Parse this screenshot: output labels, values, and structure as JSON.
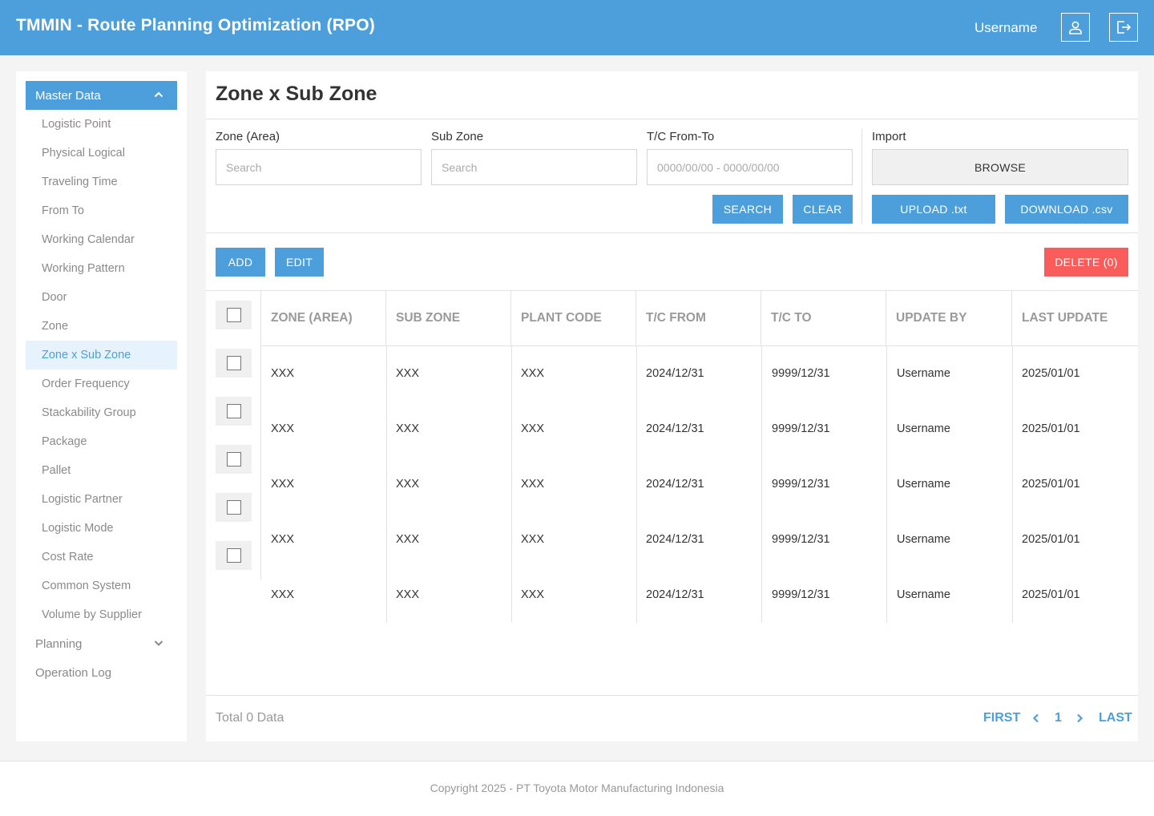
{
  "header": {
    "title": "TMMIN - Route Planning Optimization (RPO)",
    "username": "Username",
    "user_icon": "user-icon",
    "logout_icon": "logout-icon"
  },
  "sidebar": {
    "master_data": "Master Data",
    "items": [
      "Logistic Point",
      "Physical Logical",
      "Traveling Time",
      "From To",
      "Working Calendar",
      "Working Pattern",
      "Door",
      "Zone",
      "Zone x Sub Zone",
      "Order Frequency",
      "Stackability Group",
      "Package",
      "Pallet",
      "Logistic Partner",
      "Logistic Mode",
      "Cost Rate",
      "Common System",
      "Volume by Supplier"
    ],
    "selected": "Zone x Sub Zone",
    "planning": "Planning",
    "operation_log": "Operation Log"
  },
  "main": {
    "title": "Zone x Sub Zone",
    "filters": {
      "zone_label": "Zone (Area)",
      "zone_placeholder": "Search",
      "subzone_label": "Sub Zone",
      "subzone_placeholder": "Search",
      "tc_label": "T/C From-To",
      "tc_placeholder": "0000/00/00 - 0000/00/00",
      "import_label": "Import"
    },
    "buttons": {
      "browse": "BROWSE",
      "search": "SEARCH",
      "clear": "CLEAR",
      "upload": "UPLOAD .txt",
      "download": "DOWNLOAD .csv",
      "add": "ADD",
      "edit": "EDIT",
      "delete": "DELETE (0)"
    },
    "table": {
      "headers": [
        "ZONE (AREA)",
        "SUB ZONE",
        "PLANT CODE",
        "T/C FROM",
        "T/C TO",
        "UPDATE BY",
        "LAST UPDATE"
      ],
      "rows": [
        [
          "XXX",
          "XXX",
          "XXX",
          "2024/12/31",
          "9999/12/31",
          "Username",
          "2025/01/01"
        ],
        [
          "XXX",
          "XXX",
          "XXX",
          "2024/12/31",
          "9999/12/31",
          "Username",
          "2025/01/01"
        ],
        [
          "XXX",
          "XXX",
          "XXX",
          "2024/12/31",
          "9999/12/31",
          "Username",
          "2025/01/01"
        ],
        [
          "XXX",
          "XXX",
          "XXX",
          "2024/12/31",
          "9999/12/31",
          "Username",
          "2025/01/01"
        ],
        [
          "XXX",
          "XXX",
          "XXX",
          "2024/12/31",
          "9999/12/31",
          "Username",
          "2025/01/01"
        ]
      ]
    },
    "total": "Total 0 Data",
    "pagination": {
      "first": "FIRST",
      "page": "1",
      "last": "LAST"
    }
  },
  "footer": {
    "copyright": "Copyright 2025 - PT Toyota Motor Manufacturing Indonesia"
  },
  "colors": {
    "primary": "#4d9fdc",
    "danger": "#fa5c5c",
    "selected_bg": "#e6f2fc"
  }
}
